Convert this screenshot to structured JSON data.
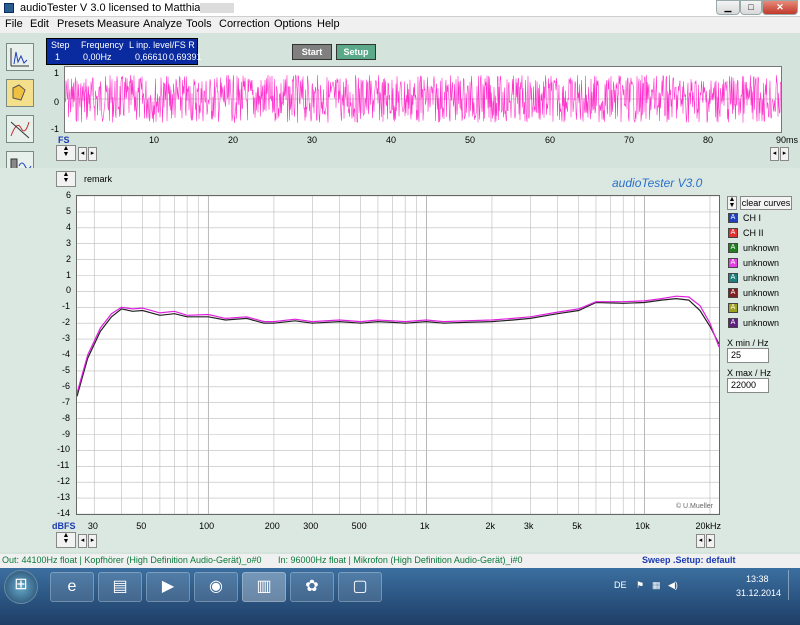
{
  "window": {
    "title": "audioTester  V 3.0   licensed to Matthias"
  },
  "menu": [
    "File",
    "Edit",
    "Presets",
    "Measure",
    "Analyze",
    "Tools",
    "Correction",
    "Options",
    "Help"
  ],
  "readout": {
    "headers": [
      "Step",
      "Frequency",
      "L  inp. level/FS  R"
    ],
    "step": "1",
    "frequency": "0,00Hz",
    "level_l": "0,66610",
    "level_r": "0,69391"
  },
  "buttons": {
    "start": "Start",
    "setup": "Setup",
    "clear_curves": "clear curves"
  },
  "scope": {
    "y_ticks": [
      "1",
      "0",
      "-1"
    ],
    "fs_label": "FS",
    "x_ticks": [
      "10",
      "20",
      "30",
      "40",
      "50",
      "60",
      "70",
      "80"
    ],
    "x_unit": "90ms",
    "trace_color": "#ff33cc"
  },
  "remark": "remark",
  "brand": "audioTester  V3.0",
  "legend": [
    {
      "letter": "A",
      "label": "CH I",
      "color": "#2040c0"
    },
    {
      "letter": "A",
      "label": "CH II",
      "color": "#e03030"
    },
    {
      "letter": "A",
      "label": "unknown",
      "color": "#208020"
    },
    {
      "letter": "A",
      "label": "unknown",
      "color": "#e040e0"
    },
    {
      "letter": "A",
      "label": "unknown",
      "color": "#208080"
    },
    {
      "letter": "A",
      "label": "unknown",
      "color": "#802020"
    },
    {
      "letter": "A",
      "label": "unknown",
      "color": "#a0a020"
    },
    {
      "letter": "A",
      "label": "unknown",
      "color": "#602080"
    }
  ],
  "range": {
    "xmin_label": "X min / Hz",
    "xmin": "25",
    "xmax_label": "X max / Hz",
    "xmax": "22000"
  },
  "copyright": "© U.Mueller",
  "chart_data": {
    "type": "line",
    "xscale": "log",
    "xlim": [
      25,
      22000
    ],
    "ylim": [
      -14,
      6
    ],
    "ylabel": "dBFS",
    "x_tick_labels": [
      {
        "v": 30,
        "t": "30"
      },
      {
        "v": 50,
        "t": "50"
      },
      {
        "v": 100,
        "t": "100"
      },
      {
        "v": 200,
        "t": "200"
      },
      {
        "v": 300,
        "t": "300"
      },
      {
        "v": 500,
        "t": "500"
      },
      {
        "v": 1000,
        "t": "1k"
      },
      {
        "v": 2000,
        "t": "2k"
      },
      {
        "v": 3000,
        "t": "3k"
      },
      {
        "v": 5000,
        "t": "5k"
      },
      {
        "v": 10000,
        "t": "10k"
      },
      {
        "v": 20000,
        "t": "20kHz"
      }
    ],
    "y_ticks": [
      6,
      5,
      4,
      3,
      2,
      1,
      0,
      -1,
      -2,
      -3,
      -4,
      -5,
      -6,
      -7,
      -8,
      -9,
      -10,
      -11,
      -12,
      -13,
      -14
    ],
    "grid": true,
    "series": [
      {
        "color": "#222222",
        "x": [
          25,
          28,
          32,
          36,
          40,
          45,
          50,
          60,
          70,
          80,
          100,
          120,
          150,
          180,
          200,
          250,
          300,
          400,
          500,
          600,
          700,
          800,
          1000,
          1200,
          1500,
          2000,
          2500,
          3000,
          4000,
          5000,
          6000,
          8000,
          10000,
          12000,
          14000,
          16000,
          18000,
          20000,
          22000
        ],
        "y": [
          -6.6,
          -4.2,
          -2.5,
          -1.6,
          -1.1,
          -1.25,
          -1.2,
          -1.5,
          -1.4,
          -1.6,
          -1.6,
          -1.8,
          -1.7,
          -2.0,
          -2.0,
          -1.85,
          -2.0,
          -1.9,
          -2.0,
          -1.9,
          -1.95,
          -2.0,
          -1.9,
          -2.0,
          -1.95,
          -1.9,
          -1.8,
          -1.7,
          -1.4,
          -1.2,
          -0.7,
          -0.75,
          -0.7,
          -0.55,
          -0.45,
          -0.55,
          -1.2,
          -2.2,
          -3.3
        ]
      },
      {
        "color": "#e020e0",
        "x": [
          25,
          28,
          32,
          36,
          40,
          45,
          50,
          60,
          70,
          80,
          100,
          120,
          150,
          180,
          200,
          250,
          300,
          400,
          500,
          600,
          700,
          800,
          1000,
          1200,
          1500,
          2000,
          2500,
          3000,
          4000,
          5000,
          6000,
          8000,
          10000,
          12000,
          14000,
          16000,
          18000,
          20000,
          22000
        ],
        "y": [
          -6.4,
          -4.0,
          -2.3,
          -1.4,
          -1.0,
          -1.1,
          -1.05,
          -1.35,
          -1.25,
          -1.5,
          -1.45,
          -1.7,
          -1.6,
          -1.9,
          -1.9,
          -1.75,
          -1.9,
          -1.8,
          -1.9,
          -1.8,
          -1.85,
          -1.9,
          -1.8,
          -1.9,
          -1.85,
          -1.8,
          -1.7,
          -1.6,
          -1.3,
          -1.1,
          -0.65,
          -0.65,
          -0.6,
          -0.45,
          -0.3,
          -0.35,
          -0.9,
          -2.0,
          -3.5
        ]
      }
    ]
  },
  "status": {
    "out": "Out: 44100Hz float  |  Kopfhörer (High Definition Audio-Gerät)_o#0",
    "in": "In: 96000Hz float  |  Mikrofon (High Definition Audio-Gerät)_i#0",
    "sweep": "Sweep  .Setup:  default"
  },
  "taskbar": {
    "lang": "DE",
    "time": "13:38",
    "date": "31.12.2014"
  }
}
